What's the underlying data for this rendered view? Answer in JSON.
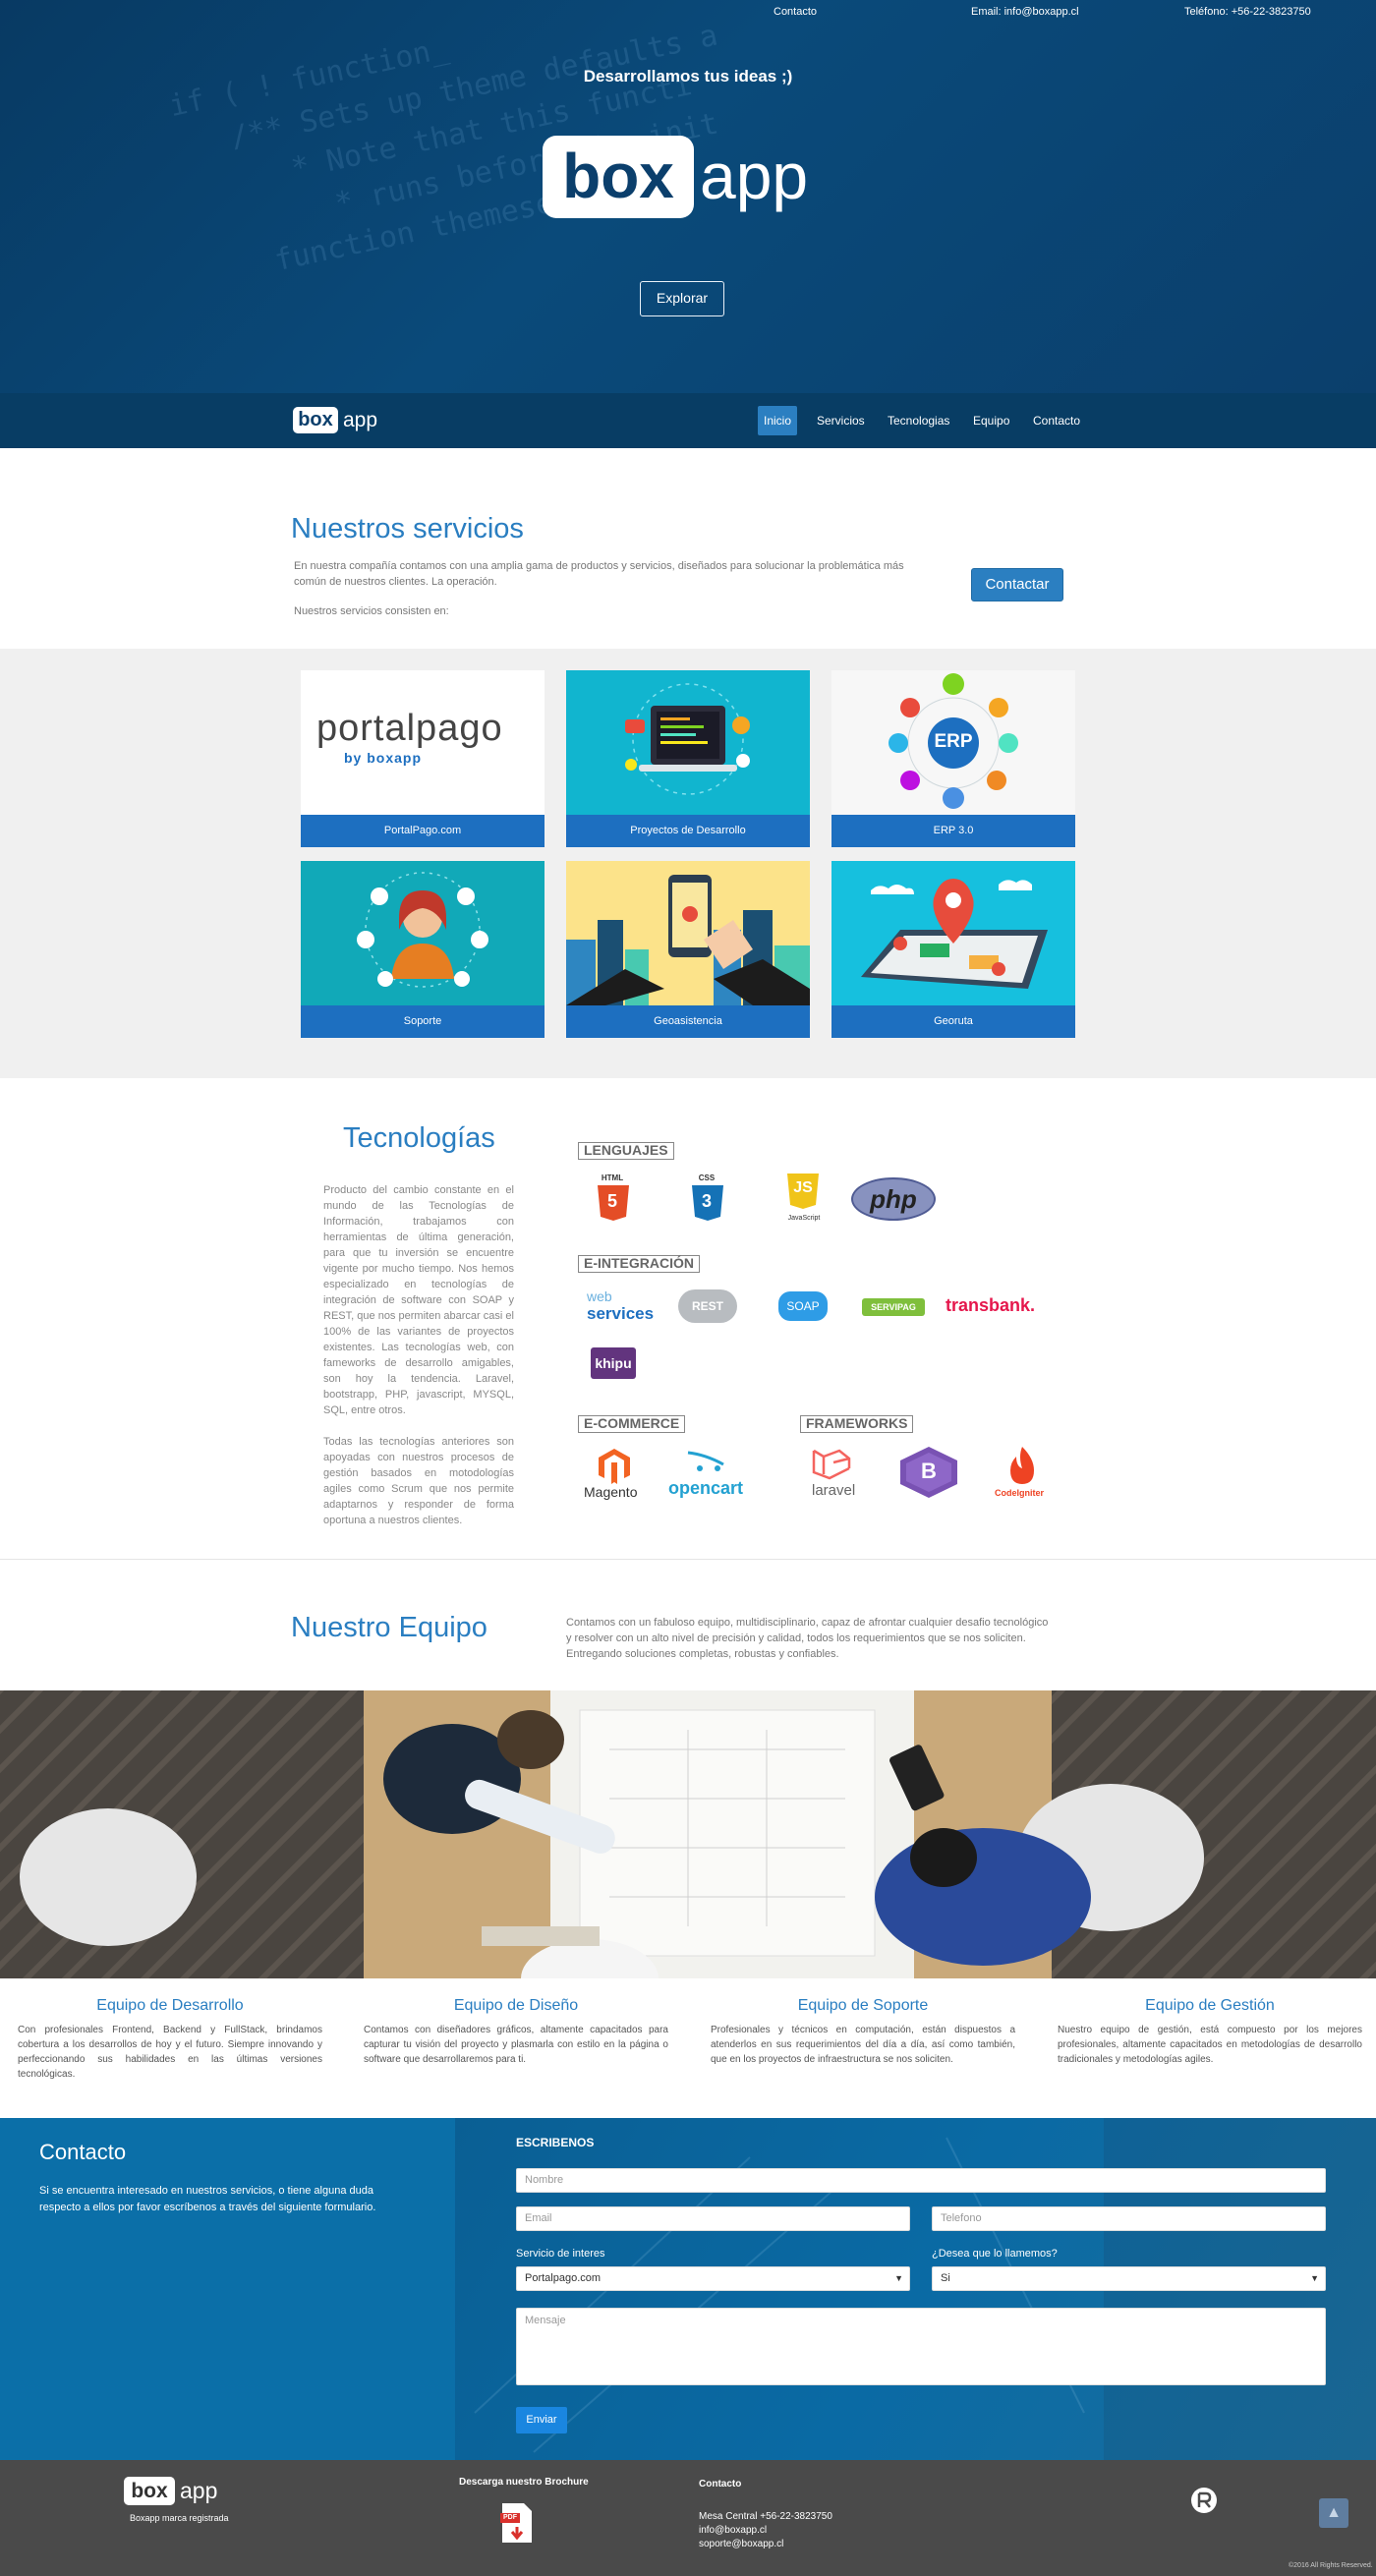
{
  "topbar": {
    "contact": "Contacto",
    "email": "Email: info@boxapp.cl",
    "phone": "Teléfono: +56-22-3823750"
  },
  "hero": {
    "tagline": "Desarrollamos tus ideas  ;)",
    "logo_box": "box",
    "logo_app": "app",
    "explore_label": "Explorar"
  },
  "nav": {
    "logo_box": "box",
    "logo_app": "app",
    "items": [
      "Inicio",
      "Servicios",
      "Tecnologias",
      "Equipo",
      "Contacto"
    ]
  },
  "services": {
    "title": "Nuestros servicios",
    "text": "En nuestra compañía contamos con una amplia gama de productos y servicios, diseñados para solucionar la problemática más común de nuestros clientes. La operación.",
    "subtitle": "Nuestros servicios consisten en:",
    "button": "Contactar",
    "cards": [
      {
        "label": "PortalPago.com",
        "logo_main": "portalpago",
        "logo_sub": "by boxapp"
      },
      {
        "label": "Proyectos de Desarrollo"
      },
      {
        "label": "ERP 3.0",
        "badge": "ERP"
      },
      {
        "label": "Soporte"
      },
      {
        "label": "Geoasistencia"
      },
      {
        "label": "Georuta"
      }
    ]
  },
  "tech": {
    "title": "Tecnologías",
    "paragraph1": "Producto del cambio constante en el mundo de las Tecnologías de Información, trabajamos con herramientas de última generación, para que tu inversión se encuentre vigente por mucho tiempo. Nos hemos especializado en tecnologías de integración de software con SOAP y REST, que nos permiten abarcar casi el 100% de las variantes de proyectos existentes. Las tecnologías web, con fameworks de desarrollo amigables, son hoy la tendencia. Laravel, bootstrapp, PHP, javascript, MYSQL, SQL, entre otros.",
    "paragraph2": "Todas las tecnologías anteriores son apoyadas con nuestros procesos de gestión basados en motodologías agiles como Scrum que nos permite adaptarnos y responder de forma oportuna a nuestros clientes.",
    "categories": {
      "lenguajes": "LENGUAJES",
      "integracion": "E-INTEGRACIÓN",
      "ecommerce": "E-COMMERCE",
      "frameworks": "FRAMEWORKS"
    },
    "logos": {
      "html": "HTML",
      "html_num": "5",
      "css": "CSS",
      "css_num": "3",
      "js": "JS",
      "js_caption": "JavaScript",
      "php": "php",
      "webservices_top": "web",
      "webservices_bottom": "services",
      "rest": "REST",
      "soap": "SOAP",
      "servipag": "SERVIPAG",
      "transbank": "transbank.",
      "khipu": "khipu",
      "magento": "Magento",
      "opencart": "opencart",
      "laravel": "laravel",
      "bootstrap": "B",
      "codeigniter": "CodeIgniter"
    }
  },
  "team": {
    "title": "Nuestro Equipo",
    "text": "Contamos con un fabuloso equipo, multidisciplinario, capaz de afrontar cualquier desafio tecnológico y resolver con un alto nivel de precisión y calidad, todos los requerimientos que se nos soliciten. Entregando soluciones completas, robustas y confiables.",
    "columns": [
      {
        "title": "Equipo de Desarrollo",
        "text": "Con profesionales Frontend, Backend y FullStack, brindamos cobertura a los desarrollos de hoy y el futuro. Siempre innovando y perfeccionando sus habilidades en las últimas versiones tecnológicas."
      },
      {
        "title": "Equipo de Diseño",
        "text": "Contamos con diseñadores gráficos, altamente capacitados para capturar tu visión del proyecto y plasmarla con estilo en la página o software que desarrollaremos para ti."
      },
      {
        "title": "Equipo de Soporte",
        "text": "Profesionales y técnicos en computación, están dispuestos a atenderlos en sus requerimientos del día a día, así como también, que en los proyectos de infraestructura se nos soliciten."
      },
      {
        "title": "Equipo de Gestión",
        "text": "Nuestro equipo de gestión, está compuesto por los mejores profesionales, altamente capacitados en metodologías de desarrollo tradicionales y metodologías agiles."
      }
    ]
  },
  "contact": {
    "title": "Contacto",
    "desc": "Si se encuentra interesado en nuestros servicios, o tiene alguna duda respecto a ellos por favor escríbenos a través del siguiente formulario.",
    "form_title": "ESCRIBENOS",
    "name_placeholder": "Nombre",
    "email_placeholder": "Email",
    "phone_placeholder": "Telefono",
    "service_label": "Servicio de interes",
    "service_value": "Portalpago.com",
    "call_label": "¿Desea que lo llamemos?",
    "call_value": "Si",
    "message_placeholder": "Mensaje",
    "send_label": "Enviar"
  },
  "footer": {
    "logo_box": "box",
    "logo_app": "app",
    "brand_note": "Boxapp marca registrada",
    "brochure_title": "Descarga nuestro Brochure",
    "contact_title": "Contacto",
    "phone": "Mesa Central +56-22-3823750",
    "email1": "info@boxapp.cl",
    "email2": "soporte@boxapp.cl",
    "copyright": "©2016 All Rights Reserved.",
    "pdf_label": "PDF"
  },
  "colors": {
    "hero_bg": "#0b3f6c",
    "accent": "#2b7fc1",
    "card_label": "#1d6fc0",
    "contact_bg": "#0b6fa8",
    "footer_bg": "#4a4a4a"
  }
}
